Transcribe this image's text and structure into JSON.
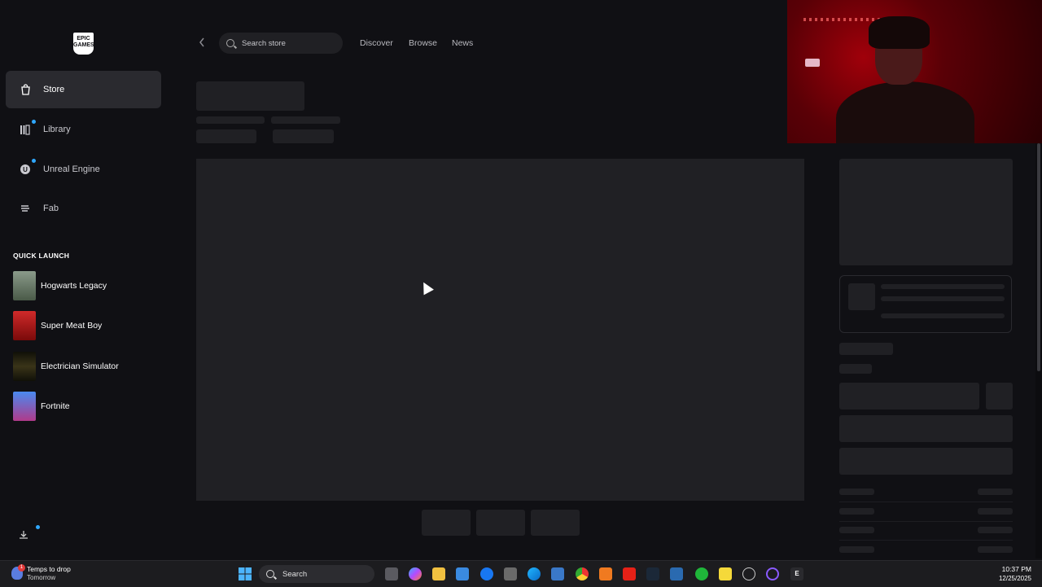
{
  "sidebar": {
    "logo_text": "EPIC GAMES",
    "nav": [
      {
        "label": "Store",
        "icon": "shopping-bag-icon"
      },
      {
        "label": "Library",
        "icon": "library-icon"
      },
      {
        "label": "Unreal Engine",
        "icon": "unreal-engine-icon"
      },
      {
        "label": "Fab",
        "icon": "fab-icon"
      }
    ],
    "quick_launch_title": "QUICK LAUNCH",
    "quick_launch": [
      {
        "label": "Hogwarts Legacy",
        "color": "#5f6e5a"
      },
      {
        "label": "Super Meat Boy",
        "color": "#b0151a"
      },
      {
        "label": "Electrician Simulator",
        "color": "#1c1c10"
      },
      {
        "label": "Fortnite",
        "color": "#3b6fd9"
      }
    ]
  },
  "header": {
    "search_placeholder": "Search store",
    "nav": [
      "Discover",
      "Browse",
      "News"
    ]
  },
  "taskbar": {
    "weather_title": "Temps to drop",
    "weather_sub": "Tomorrow",
    "weather_badge": "1",
    "search_label": "Search",
    "time": "10:37 PM",
    "date": "12/25/2025"
  },
  "colors": {
    "background": "#101014",
    "skeleton": "#202024",
    "active_nav": "#2a2a2f",
    "notification_dot": "#2fa8ff"
  }
}
